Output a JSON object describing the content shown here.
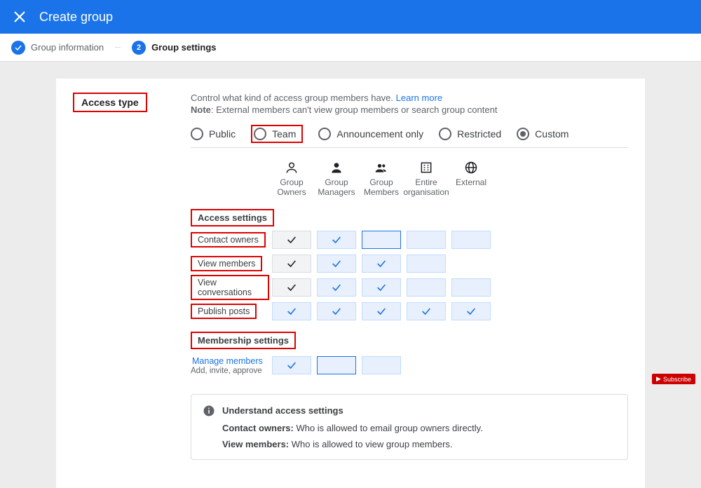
{
  "header": {
    "title": "Create group"
  },
  "stepper": {
    "step1_label": "Group information",
    "step2_label": "Group settings",
    "step2_num": "2"
  },
  "access_type": {
    "section_label": "Access type",
    "help": "Control what kind of access group members have.",
    "learn_more": "Learn more",
    "note_bold": "Note",
    "note_text": ": External members can't view group members or search group content",
    "options": {
      "public": "Public",
      "team": "Team",
      "announcement": "Announcement only",
      "restricted": "Restricted",
      "custom": "Custom"
    },
    "selected": "custom"
  },
  "columns": {
    "owners": "Group Owners",
    "managers": "Group Managers",
    "members": "Group Members",
    "org": "Entire organisation",
    "external": "External"
  },
  "access_settings": {
    "heading": "Access settings",
    "rows": {
      "contact": {
        "label": "Contact owners",
        "cells": [
          "grey-check",
          "blue-check",
          "selblue-empty",
          "blue-empty",
          "blue-empty"
        ]
      },
      "view_members": {
        "label": "View members",
        "cells": [
          "grey-check",
          "blue-check",
          "blue-check",
          "blue-empty",
          null
        ]
      },
      "view_conv": {
        "label": "View conversations",
        "cells": [
          "grey-check",
          "blue-check",
          "blue-check",
          "blue-empty",
          "blue-empty"
        ]
      },
      "publish": {
        "label": "Publish posts",
        "cells": [
          "blue-check",
          "blue-check",
          "blue-check",
          "blue-check",
          "blue-check"
        ]
      }
    }
  },
  "membership_settings": {
    "heading": "Membership settings",
    "manage": {
      "label": "Manage members",
      "sub": "Add, invite, approve",
      "cells": [
        "blue-check",
        "selblue-empty",
        "blue-empty",
        null,
        null
      ]
    }
  },
  "info": {
    "title": "Understand access settings",
    "contact_bold": "Contact owners:",
    "contact_text": " Who is allowed to email group owners directly.",
    "members_bold": "View members:",
    "members_text": " Who is allowed to view group members."
  },
  "overlay": {
    "subscribe": "Subscribe"
  }
}
